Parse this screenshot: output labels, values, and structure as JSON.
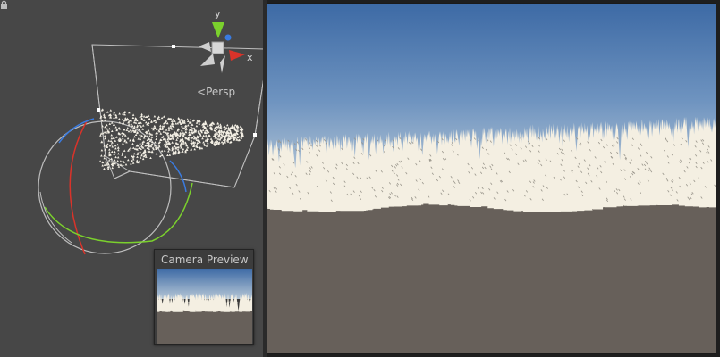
{
  "scene_view": {
    "gizmo": {
      "y_label": "y",
      "x_label": "x",
      "persp_glyph": "<",
      "persp_label": "Persp",
      "lock_icon": "lock-icon"
    },
    "colors": {
      "background": "#474747",
      "axis_x": "#d9332a",
      "axis_y": "#7bd12d",
      "axis_z": "#3a7be0",
      "frustum": "#bfbfbf",
      "trees": "#f3efe4"
    }
  },
  "game_view": {
    "colors": {
      "sky_top": "#3d6aa5",
      "sky_horizon": "#b6c7d6",
      "ground": "#67605a",
      "trees": "#f4efe2"
    }
  },
  "camera_preview": {
    "title": "Camera Preview"
  }
}
